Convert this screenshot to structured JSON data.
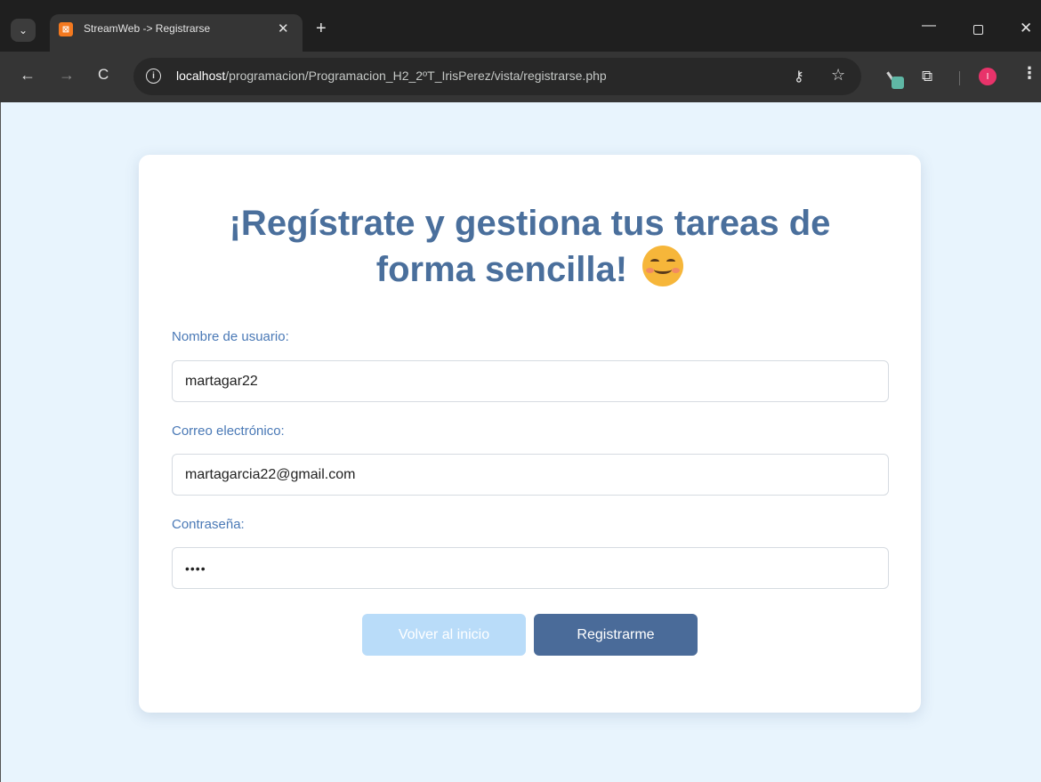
{
  "browser": {
    "tab": {
      "favicon_text": "⊠",
      "title": "StreamWeb -> Registrarse",
      "close": "✕"
    },
    "new_tab": "+",
    "window": {
      "minimize": "—",
      "close": "✕"
    },
    "nav": {
      "back": "←",
      "forward": "→",
      "reload": "C"
    },
    "url": {
      "host": "localhost",
      "path": "/programacion/Programacion_H2_2ºT_IrisPerez/vista/registrarse.php"
    },
    "profile_initial": "I",
    "icons": {
      "key": "⚷",
      "star": "☆",
      "puzzle": "⧉",
      "menu": "⋮",
      "tab_search": "⌄"
    }
  },
  "page": {
    "headline_line1": "¡Regístrate y gestiona tus tareas de",
    "headline_line2": "forma sencilla!",
    "fields": {
      "username": {
        "label": "Nombre de usuario:",
        "value": "martagar22"
      },
      "email": {
        "label": "Correo electrónico:",
        "value": "martagarcia22@gmail.com"
      },
      "password": {
        "label": "Contraseña:",
        "value": "1234"
      }
    },
    "buttons": {
      "back": "Volver al inicio",
      "register": "Registrarme"
    }
  },
  "colors": {
    "page_bg": "#e8f4fd",
    "headline": "#4a6f9c",
    "label": "#4a79b6",
    "button_primary": "#4a6b99",
    "button_disabled": "#b9dcf9"
  }
}
